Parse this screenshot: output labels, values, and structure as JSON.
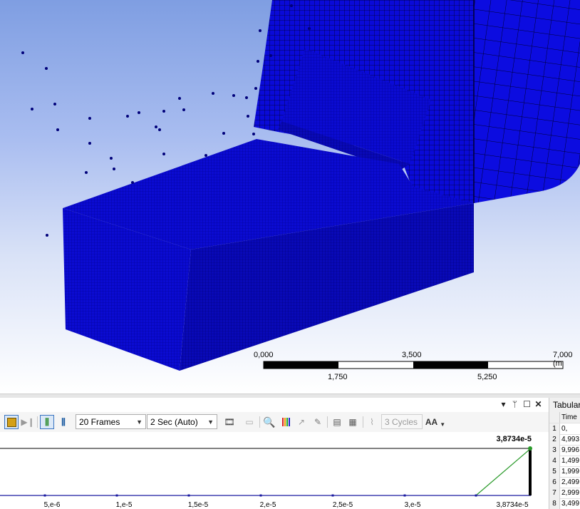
{
  "scale_bar": {
    "top_labels": [
      "0,000",
      "3,500",
      "7,000 (m"
    ],
    "bottom_labels": [
      "1,750",
      "5,250"
    ]
  },
  "graph_panel": {
    "titlebar_icons": [
      "dropdown-arrow-icon",
      "pin-icon",
      "maximize-icon",
      "close-icon"
    ],
    "frames": {
      "selected": "20 Frames"
    },
    "duration": {
      "selected": "2 Sec (Auto)"
    },
    "cycles": {
      "value": "3 Cycles"
    },
    "aa_label": "AA",
    "peak_label": "3,8734e-5",
    "x_ticks": [
      "5,e-6",
      "1,e-5",
      "1,5e-5",
      "2,e-5",
      "2,5e-5",
      "3,e-5",
      "3,8734e-5"
    ]
  },
  "tabular": {
    "title": "Tabular",
    "header": "Time",
    "rows": [
      {
        "n": "1",
        "v": "0,"
      },
      {
        "n": "2",
        "v": "4,993"
      },
      {
        "n": "3",
        "v": "9,996"
      },
      {
        "n": "4",
        "v": "1,499"
      },
      {
        "n": "5",
        "v": "1,999"
      },
      {
        "n": "6",
        "v": "2,499"
      },
      {
        "n": "7",
        "v": "2,999"
      },
      {
        "n": "8",
        "v": "3,499"
      }
    ]
  },
  "colors": {
    "mesh_blue": "#0a0ad0",
    "mesh_dark": "#000080",
    "timeline_green": "#2a9a2a",
    "timeline_blue": "#1a1aa0"
  }
}
